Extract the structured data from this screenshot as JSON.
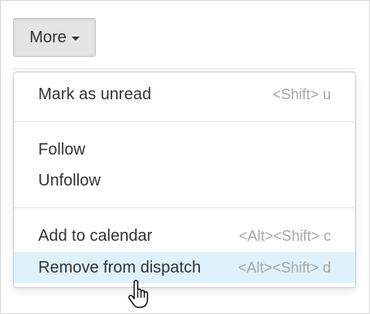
{
  "more_button": {
    "label": "More",
    "caret_icon": "caret-down-icon"
  },
  "menu": {
    "items": [
      {
        "label": "Mark as unread",
        "shortcut": "<Shift> u"
      },
      {
        "label": "Follow",
        "shortcut": ""
      },
      {
        "label": "Unfollow",
        "shortcut": ""
      },
      {
        "label": "Add to calendar",
        "shortcut": "<Alt><Shift> c"
      },
      {
        "label": "Remove from dispatch",
        "shortcut": "<Alt><Shift> d"
      }
    ],
    "highlighted_item": "Remove from dispatch",
    "highlight_color": "#dff1fa"
  },
  "pointer": {
    "icon": "hand-pointer-icon"
  }
}
